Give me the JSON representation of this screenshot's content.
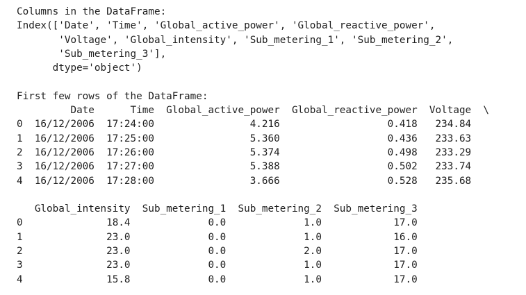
{
  "output": {
    "lines": [
      "Columns in the DataFrame:",
      "Index(['Date', 'Time', 'Global_active_power', 'Global_reactive_power',",
      "       'Voltage', 'Global_intensity', 'Sub_metering_1', 'Sub_metering_2',",
      "       'Sub_metering_3'],",
      "      dtype='object')",
      "",
      "First few rows of the DataFrame:",
      "         Date      Time  Global_active_power  Global_reactive_power  Voltage  \\",
      "0  16/12/2006  17:24:00                4.216                  0.418   234.84",
      "1  16/12/2006  17:25:00                5.360                  0.436   233.63",
      "2  16/12/2006  17:26:00                5.374                  0.498   233.29",
      "3  16/12/2006  17:27:00                5.388                  0.502   233.74",
      "4  16/12/2006  17:28:00                3.666                  0.528   235.68",
      "",
      "   Global_intensity  Sub_metering_1  Sub_metering_2  Sub_metering_3",
      "0              18.4             0.0             1.0            17.0",
      "1              23.0             0.0             1.0            16.0",
      "2              23.0             0.0             2.0            17.0",
      "3              23.0             0.0             1.0            17.0",
      "4              15.8             0.0             1.0            17.0"
    ]
  }
}
